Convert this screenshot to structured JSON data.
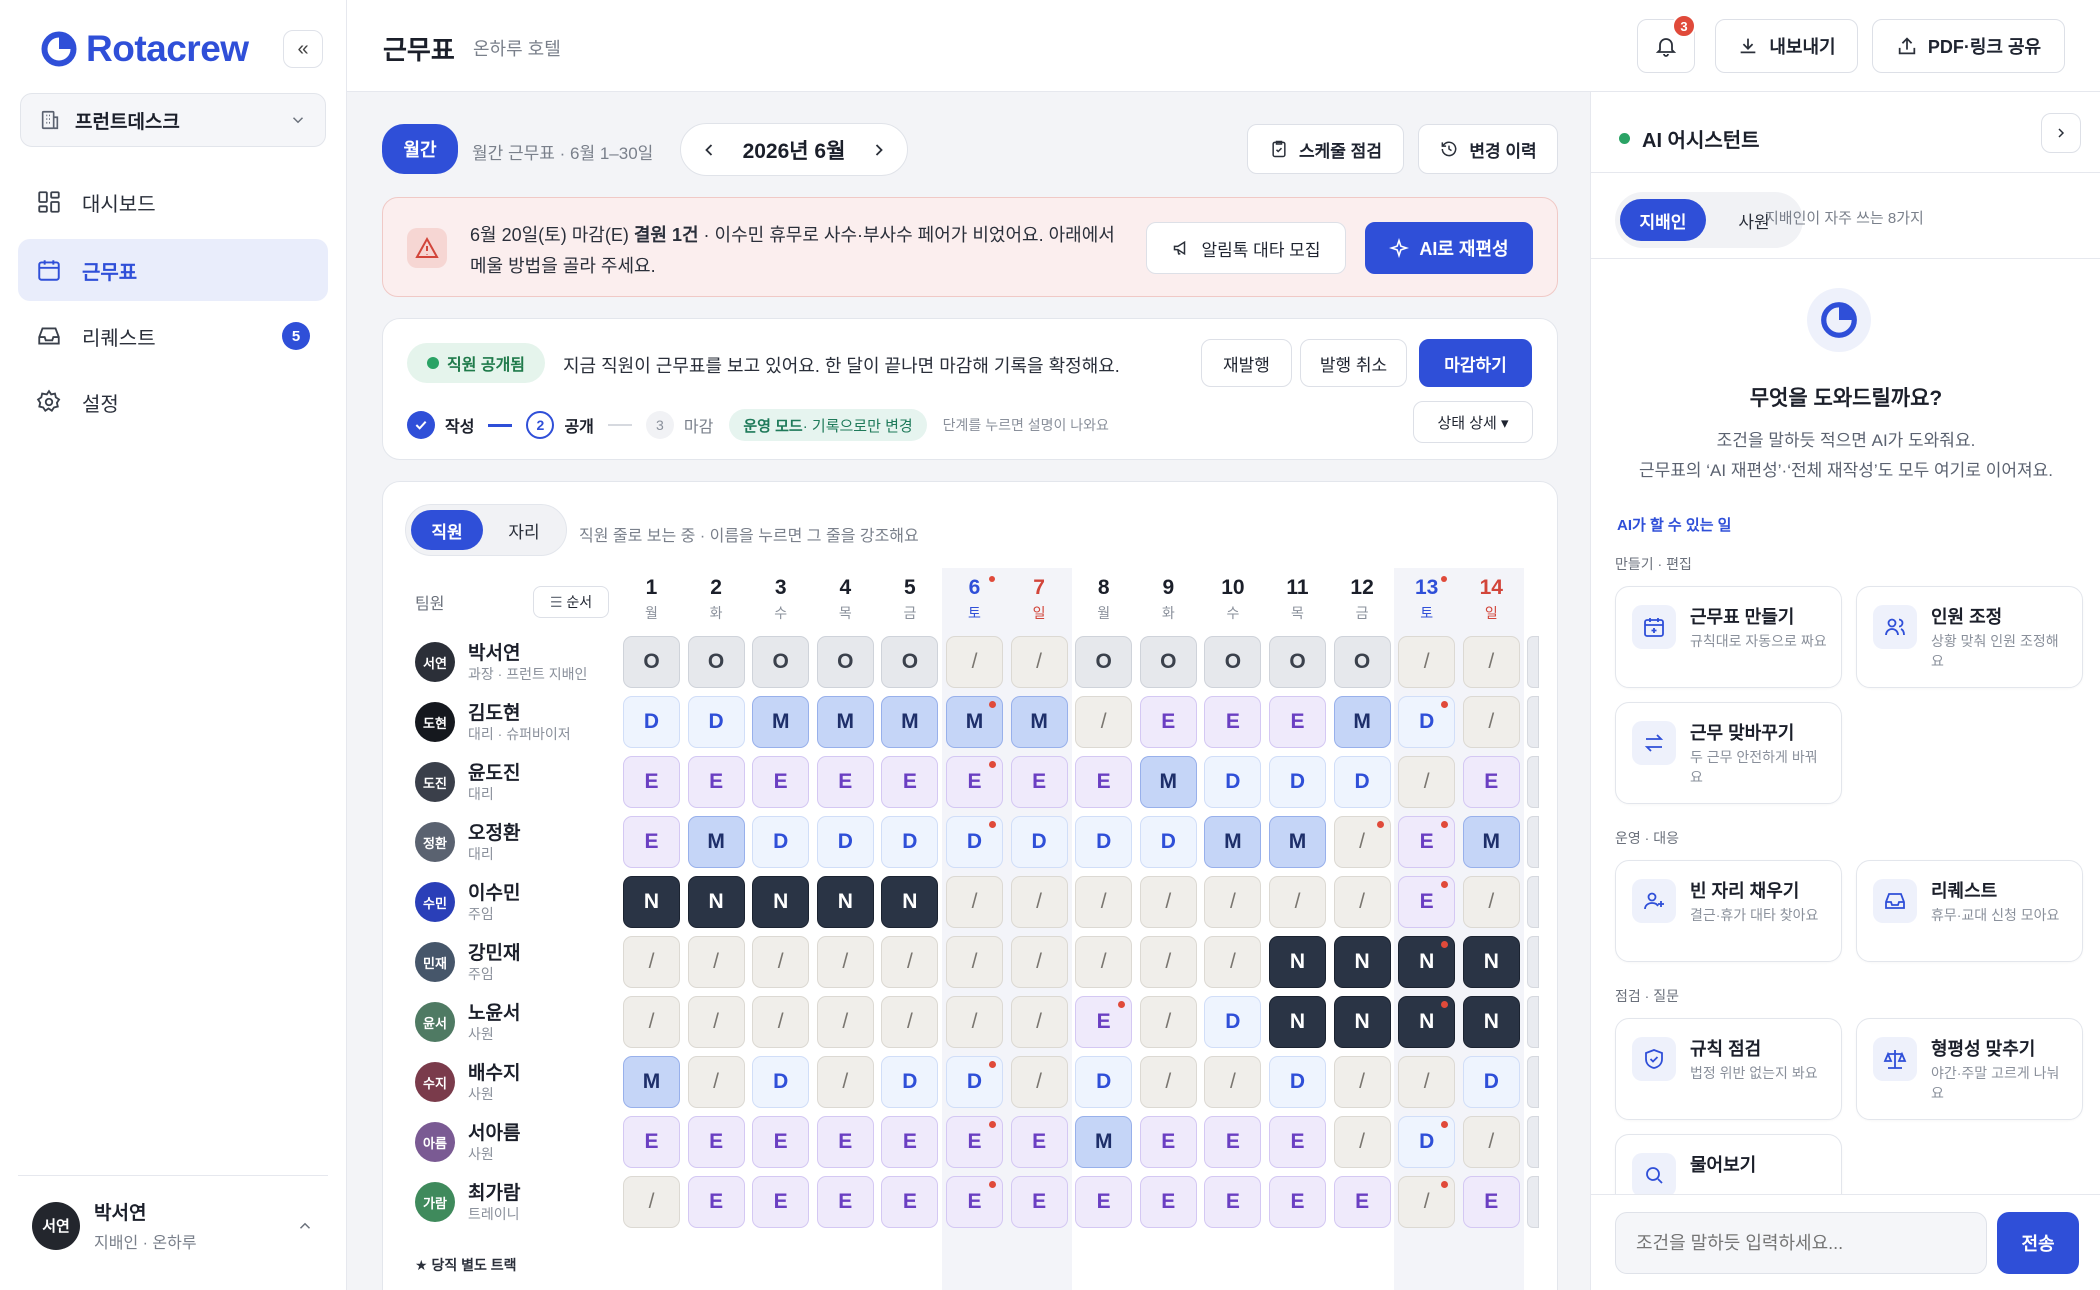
{
  "brand": {
    "name": "Rotacrew",
    "collapse_label": "«",
    "accent": "#2f4fd8"
  },
  "workspace": {
    "name": "프런트데스크"
  },
  "nav": [
    {
      "label": "대시보드",
      "icon": "grid-icon"
    },
    {
      "label": "근무표",
      "icon": "calendar-icon",
      "active": true
    },
    {
      "label": "리퀘스트",
      "icon": "inbox-icon",
      "badge": "5"
    },
    {
      "label": "설정",
      "icon": "gear-icon"
    }
  ],
  "user": {
    "avatar": "서연",
    "name": "박서연",
    "role": "지배인 · 온하루"
  },
  "header": {
    "title": "근무표",
    "subtitle": "온하루 호텔",
    "notif_count": "3",
    "export_label": "내보내기",
    "share_label": "PDF·링크 공유"
  },
  "toolbar": {
    "view_label": "월간",
    "range_label": "월간 근무표 · 6월 1–30일",
    "month": "2026년 6월",
    "check_label": "스케줄 점검",
    "history_label": "변경 이력"
  },
  "alert": {
    "line1_pre": "6월 20일(토) 마감(E) ",
    "line1_bold": "결원 1건",
    "line1_post": " · 이수민 휴무로 사수·부사수 페어가 비었어요. 아래에서",
    "line2": "메울 방법을 골라 주세요.",
    "recruit_label": "알림톡 대타 모집",
    "ai_label": "AI로 재편성",
    "color": "#fbeeee"
  },
  "publish": {
    "status_label": "직원 공개됨",
    "message": "지금 직원이 근무표를 보고 있어요. 한 달이 끝나면 마감해 기록을 확정해요.",
    "republish_label": "재발행",
    "unpublish_label": "발행 취소",
    "close_label": "마감하기",
    "steps": [
      {
        "num": "",
        "label": "작성"
      },
      {
        "num": "2",
        "label": "공개"
      },
      {
        "num": "3",
        "label": "마감"
      }
    ],
    "mode_label": "운영 모드",
    "mode_note": " · 기록으로만 변경",
    "hint": "단계를 누르면 설명이 나와요",
    "detail_label": "상태 상세 ▾"
  },
  "schedule": {
    "toggle": [
      "직원",
      "자리"
    ],
    "hint": "직원 줄로 보는 중 · 이름을 누르면 그 줄을 강조해요",
    "team_label": "팀원",
    "order_label": "순서",
    "days": [
      {
        "d": "1",
        "w": "월"
      },
      {
        "d": "2",
        "w": "화"
      },
      {
        "d": "3",
        "w": "수"
      },
      {
        "d": "4",
        "w": "목"
      },
      {
        "d": "5",
        "w": "금"
      },
      {
        "d": "6",
        "w": "토",
        "type": "sat",
        "dot": true
      },
      {
        "d": "7",
        "w": "일",
        "type": "sun"
      },
      {
        "d": "8",
        "w": "월"
      },
      {
        "d": "9",
        "w": "화"
      },
      {
        "d": "10",
        "w": "수"
      },
      {
        "d": "11",
        "w": "목"
      },
      {
        "d": "12",
        "w": "금"
      },
      {
        "d": "13",
        "w": "토",
        "type": "sat",
        "dot": true
      },
      {
        "d": "14",
        "w": "일",
        "type": "sun"
      }
    ],
    "employees": [
      {
        "avatar": "서연",
        "color": "#2b2f38",
        "name": "박서연",
        "role": "과장 · 프런트 지배인",
        "shifts": [
          "O",
          "O",
          "O",
          "O",
          "O",
          "/",
          "/",
          "O",
          "O",
          "O",
          "O",
          "O",
          "/",
          "/"
        ],
        "dots": []
      },
      {
        "avatar": "도현",
        "color": "#15181e",
        "name": "김도현",
        "role": "대리 · 슈퍼바이저",
        "shifts": [
          "D",
          "D",
          "M",
          "M",
          "M",
          "M",
          "M",
          "/",
          "E",
          "E",
          "E",
          "M",
          "D",
          "/"
        ],
        "dots": [
          5,
          12
        ]
      },
      {
        "avatar": "도진",
        "color": "#3a3f4a",
        "name": "윤도진",
        "role": "대리",
        "shifts": [
          "E",
          "E",
          "E",
          "E",
          "E",
          "E",
          "E",
          "E",
          "M",
          "D",
          "D",
          "D",
          "/",
          "E"
        ],
        "dots": [
          5
        ]
      },
      {
        "avatar": "정환",
        "color": "#5a6270",
        "name": "오정환",
        "role": "대리",
        "shifts": [
          "E",
          "M",
          "D",
          "D",
          "D",
          "D",
          "D",
          "D",
          "D",
          "M",
          "M",
          "/",
          "E",
          "M"
        ],
        "dots": [
          5,
          11,
          12
        ]
      },
      {
        "avatar": "수민",
        "color": "#2a3fb8",
        "name": "이수민",
        "role": "주임",
        "shifts": [
          "N",
          "N",
          "N",
          "N",
          "N",
          "/",
          "/",
          "/",
          "/",
          "/",
          "/",
          "/",
          "E",
          "/"
        ],
        "dots": [
          12
        ]
      },
      {
        "avatar": "민재",
        "color": "#46566a",
        "name": "강민재",
        "role": "주임",
        "shifts": [
          "/",
          "/",
          "/",
          "/",
          "/",
          "/",
          "/",
          "/",
          "/",
          "/",
          "N",
          "N",
          "N",
          "N"
        ],
        "dots": [
          12
        ]
      },
      {
        "avatar": "윤서",
        "color": "#4f7a63",
        "name": "노윤서",
        "role": "사원",
        "shifts": [
          "/",
          "/",
          "/",
          "/",
          "/",
          "/",
          "/",
          "E",
          "/",
          "D",
          "N",
          "N",
          "N",
          "N"
        ],
        "dots": [
          7,
          12
        ]
      },
      {
        "avatar": "수지",
        "color": "#7a3b4b",
        "name": "배수지",
        "role": "사원",
        "shifts": [
          "M",
          "/",
          "D",
          "/",
          "D",
          "D",
          "/",
          "D",
          "/",
          "/",
          "D",
          "/",
          "/",
          "D"
        ],
        "dots": [
          5
        ]
      },
      {
        "avatar": "아름",
        "color": "#7a5a93",
        "name": "서아름",
        "role": "사원",
        "shifts": [
          "E",
          "E",
          "E",
          "E",
          "E",
          "E",
          "E",
          "M",
          "E",
          "E",
          "E",
          "/",
          "D",
          "/"
        ],
        "dots": [
          5,
          12
        ]
      },
      {
        "avatar": "가람",
        "color": "#3f8a5c",
        "name": "최가람",
        "role": "트레이니",
        "shifts": [
          "/",
          "E",
          "E",
          "E",
          "E",
          "E",
          "E",
          "E",
          "E",
          "E",
          "E",
          "E",
          "/",
          "E"
        ],
        "dots": [
          5,
          12
        ]
      }
    ],
    "track_label": "★ 당직 별도 트랙"
  },
  "ai": {
    "title": "AI 어시스턴트",
    "tabs": [
      "지배인",
      "사원"
    ],
    "tabs_hint": "지배인이 자주 쓰는 8가지",
    "question": "무엇을 도와드릴까요?",
    "desc1": "조건을 말하듯 적으면 AI가 도와줘요.",
    "desc2": "근무표의 ‘AI 재편성’·‘전체 재작성’도 모두 여기로 이어져요.",
    "section_label": "AI가 할 수 있는 일",
    "groups": [
      {
        "label": "만들기 · 편집",
        "items": [
          {
            "title": "근무표 만들기",
            "desc": "규칙대로 자동으로 짜요",
            "icon": "calendar-plus-icon"
          },
          {
            "title": "인원 조정",
            "desc": "상황 맞춰 인원 조정해요",
            "icon": "users-icon"
          },
          {
            "title": "근무 맞바꾸기",
            "desc": "두 근무 안전하게 바꿔요",
            "icon": "swap-icon"
          }
        ]
      },
      {
        "label": "운영 · 대응",
        "items": [
          {
            "title": "빈 자리 채우기",
            "desc": "결근·휴가 대타 찾아요",
            "icon": "user-plus-icon"
          },
          {
            "title": "리퀘스트",
            "desc": "휴무·교대 신청 모아요",
            "icon": "inbox-icon"
          }
        ]
      },
      {
        "label": "점검 · 질문",
        "items": [
          {
            "title": "규칙 점검",
            "desc": "법정 위반 없는지 봐요",
            "icon": "shield-icon"
          },
          {
            "title": "형평성 맞추기",
            "desc": "야간·주말 고르게 나눠요",
            "icon": "scale-icon"
          },
          {
            "title": "물어보기",
            "desc": "",
            "icon": "search-icon"
          }
        ]
      }
    ],
    "input_placeholder": "조건을 말하듯 입력하세요...",
    "send_label": "전송"
  }
}
